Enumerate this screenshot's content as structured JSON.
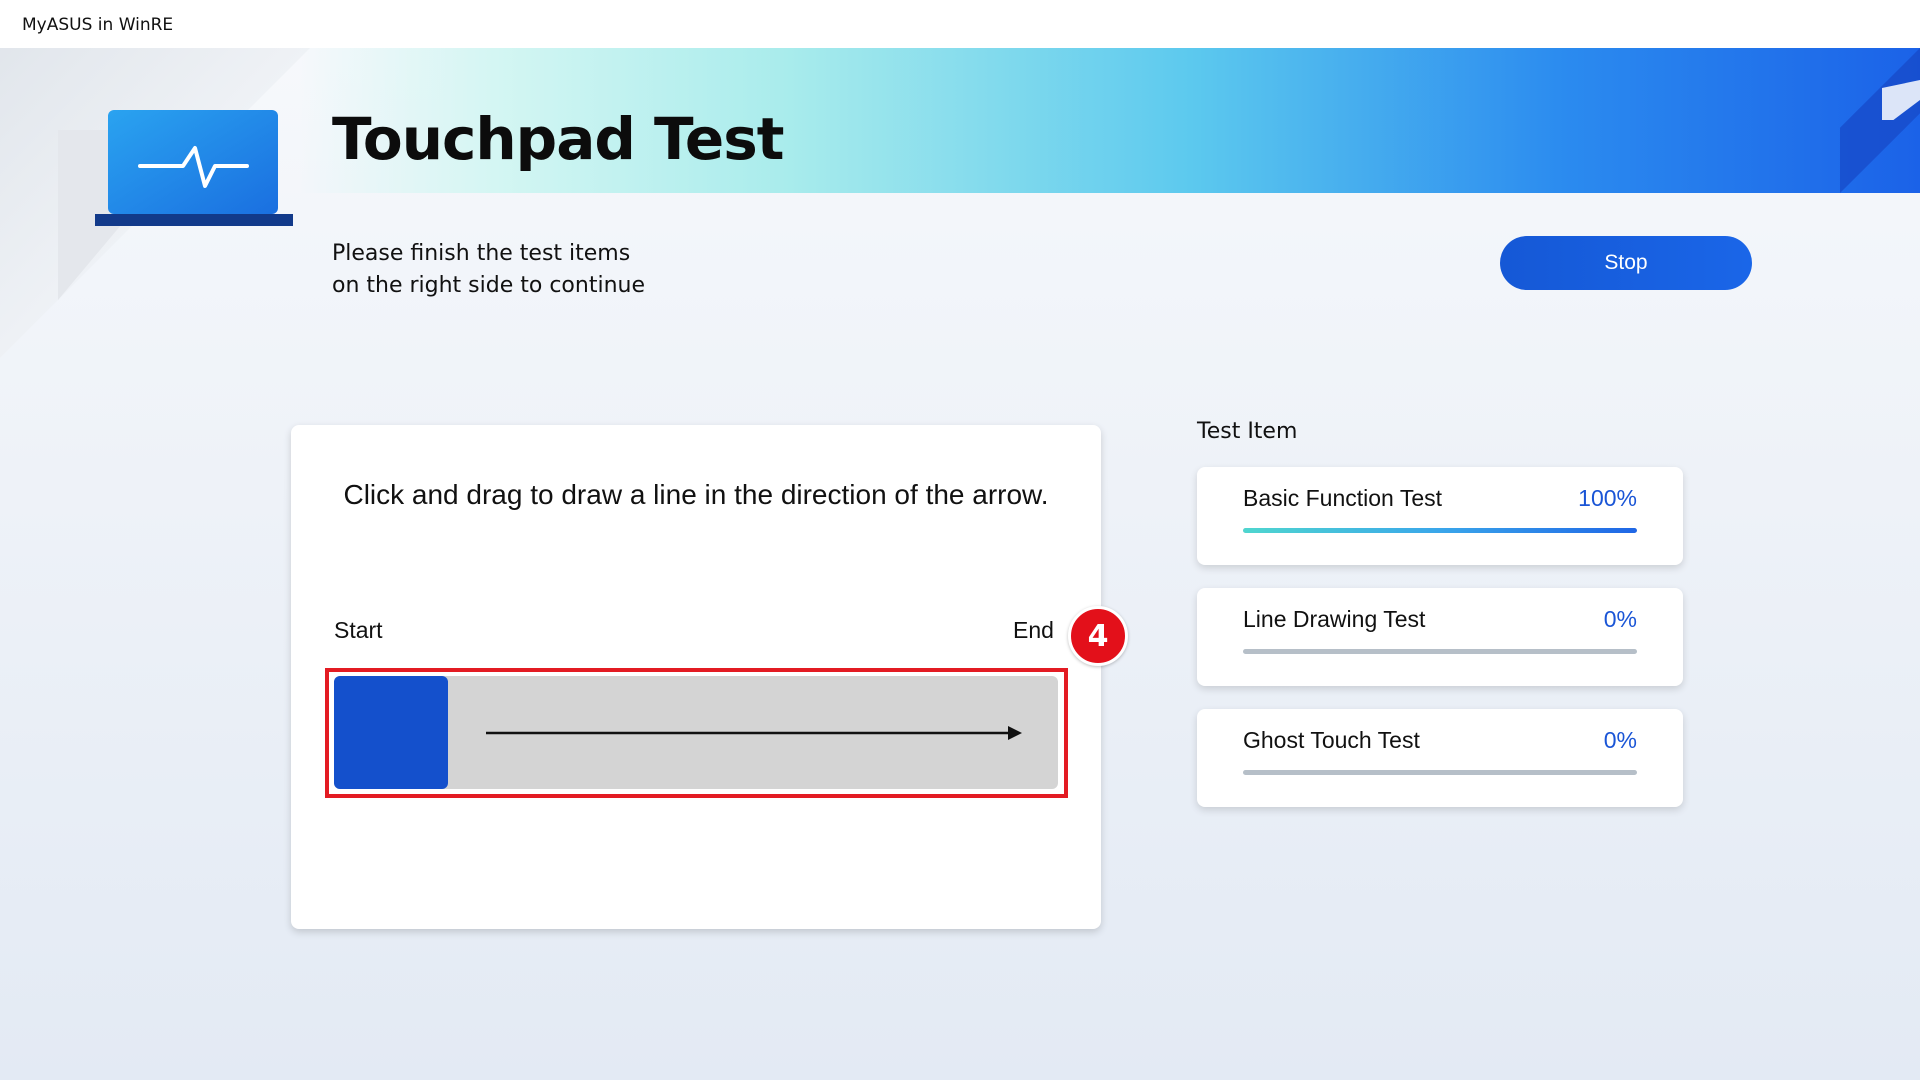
{
  "window": {
    "title": "MyASUS in WinRE"
  },
  "header": {
    "title": "Touchpad Test",
    "subtitle": "Please finish the test items on the right side to continue",
    "stop_label": "Stop"
  },
  "drawing_panel": {
    "instruction": "Click and drag to draw a line in the direction of the arrow.",
    "start_label": "Start",
    "end_label": "End",
    "step_badge": "4"
  },
  "test_items": {
    "heading": "Test Item",
    "items": [
      {
        "name": "Basic Function Test",
        "progress_text": "100%",
        "progress": 1.0
      },
      {
        "name": "Line Drawing Test",
        "progress_text": "0%",
        "progress": 0.0
      },
      {
        "name": "Ghost Touch Test",
        "progress_text": "0%",
        "progress": 0.0
      }
    ]
  },
  "colors": {
    "accent": "#1450cc",
    "button": "#1a5fe0",
    "highlight": "#e31b23",
    "badge": "#e3101a"
  },
  "icons": [
    "laptop-heartbeat-icon",
    "arrow-right-icon"
  ]
}
